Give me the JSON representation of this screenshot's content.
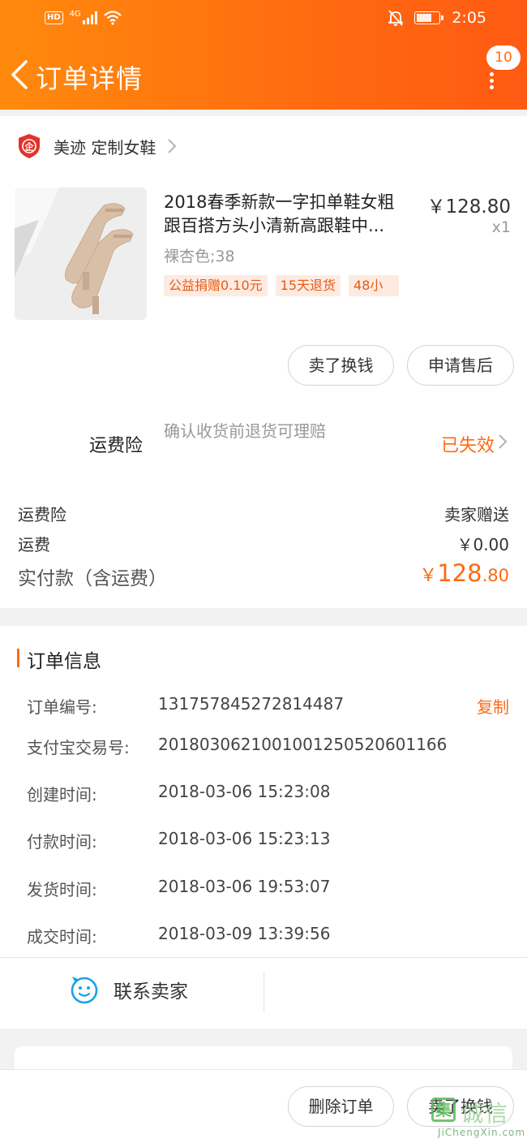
{
  "status_bar": {
    "hd": "HD",
    "network": "4G",
    "time": "2:05"
  },
  "nav": {
    "title": "订单详情",
    "badge_count": "10"
  },
  "shop": {
    "name": "美迹 定制女鞋"
  },
  "product": {
    "title_line1": "2018春季新款一字扣单鞋女粗",
    "title_line2": "跟百搭方头小清新高跟鞋中...",
    "price": "￥128.80",
    "qty": "x1",
    "sku": "裸杏色;38",
    "tags": [
      "公益捐赠0.10元",
      "15天退货",
      "48小"
    ]
  },
  "actions": {
    "sell": "卖了换钱",
    "after_sale": "申请售后"
  },
  "insurance": {
    "title": "运费险",
    "desc": "确认收货前退货可理赔",
    "status": "已失效"
  },
  "fees": {
    "insurance_label": "运费险",
    "insurance_value": "卖家赠送",
    "shipping_label": "运费",
    "shipping_value": "￥0.00",
    "paid_label": "实付款（含运费）",
    "paid_currency": "￥",
    "paid_int": "128",
    "paid_dec": ".80"
  },
  "order_info": {
    "section_title": "订单信息",
    "copy": "复制",
    "rows": [
      {
        "label": "订单编号:",
        "value": "131757845272814487"
      },
      {
        "label": "支付宝交易号:",
        "value": "2018030621001001250520601166"
      },
      {
        "label": "创建时间:",
        "value": "2018-03-06 15:23:08"
      },
      {
        "label": "付款时间:",
        "value": "2018-03-06 15:23:13"
      },
      {
        "label": "发货时间:",
        "value": "2018-03-06 19:53:07"
      },
      {
        "label": "成交时间:",
        "value": "2018-03-09 13:39:56"
      }
    ],
    "contact": "联系卖家"
  },
  "bottom": {
    "delete": "删除订单",
    "sell": "卖了换钱"
  },
  "watermark": {
    "box": "集",
    "text": "诚信",
    "url": "JiChengXin.com"
  },
  "colors": {
    "accent": "#ff6a10",
    "header_start": "#ff8a0d",
    "tag_bg": "#fdebe2"
  }
}
